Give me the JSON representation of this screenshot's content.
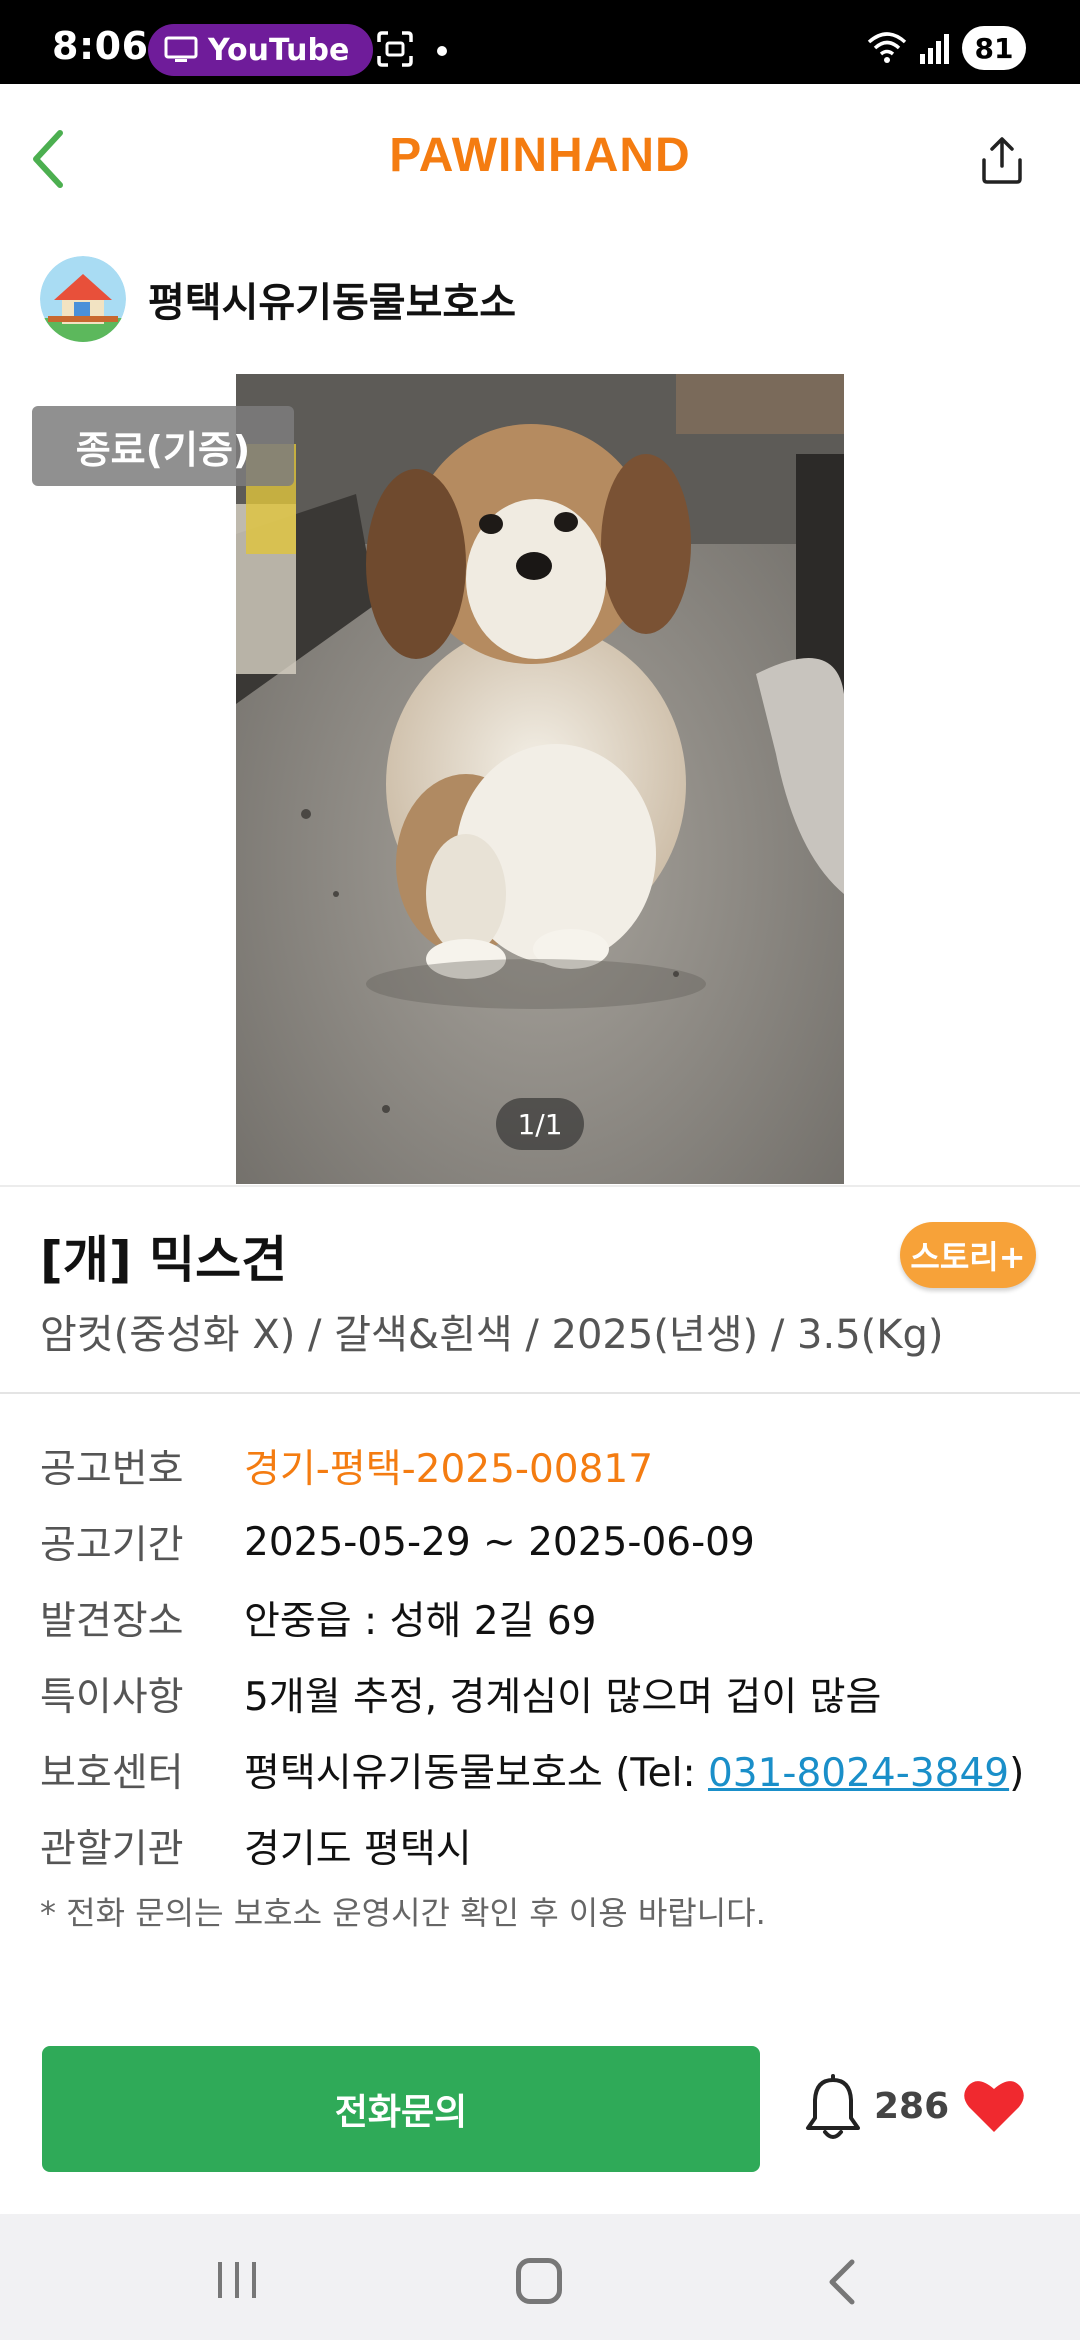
{
  "status_bar": {
    "time": "8:06",
    "app_badge": "YouTube",
    "battery": "81"
  },
  "header": {
    "brand": "PAWINHAND"
  },
  "shelter": {
    "name": "평택시유기동물보호소"
  },
  "photo": {
    "status_tag": "종료(기증)",
    "pager": "1/1"
  },
  "animal": {
    "title": "[개] 믹스견",
    "story_badge": "스토리+",
    "subtitle": "암컷(중성화 X) / 갈색&흰색 / 2025(년생) / 3.5(Kg)"
  },
  "info": {
    "notice_no_label": "공고번호",
    "notice_no_value": "경기-평택-2025-00817",
    "period_label": "공고기간",
    "period_value": "2025-05-29 ~ 2025-06-09",
    "found_label": "발견장소",
    "found_value": "안중읍 : 성해 2길 69",
    "notes_label": "특이사항",
    "notes_value": "5개월 추정, 경계심이 많으며 겁이 많음",
    "center_label": "보호센터",
    "center_value": "평택시유기동물보호소 (Tel: ",
    "center_phone": "031-8024-3849",
    "center_close": ")",
    "authority_label": "관할기관",
    "authority_value": "경기도 평택시",
    "note": "* 전화 문의는 보호소 운영시간 확인 후 이용 바랍니다."
  },
  "actions": {
    "call_label": "전화문의",
    "alarm_count": "286"
  },
  "colors": {
    "brand": "#f47c11",
    "call_button": "#2faa58",
    "story_badge": "#f7a239",
    "link": "#1a8fc9",
    "heart": "#f0292f"
  }
}
